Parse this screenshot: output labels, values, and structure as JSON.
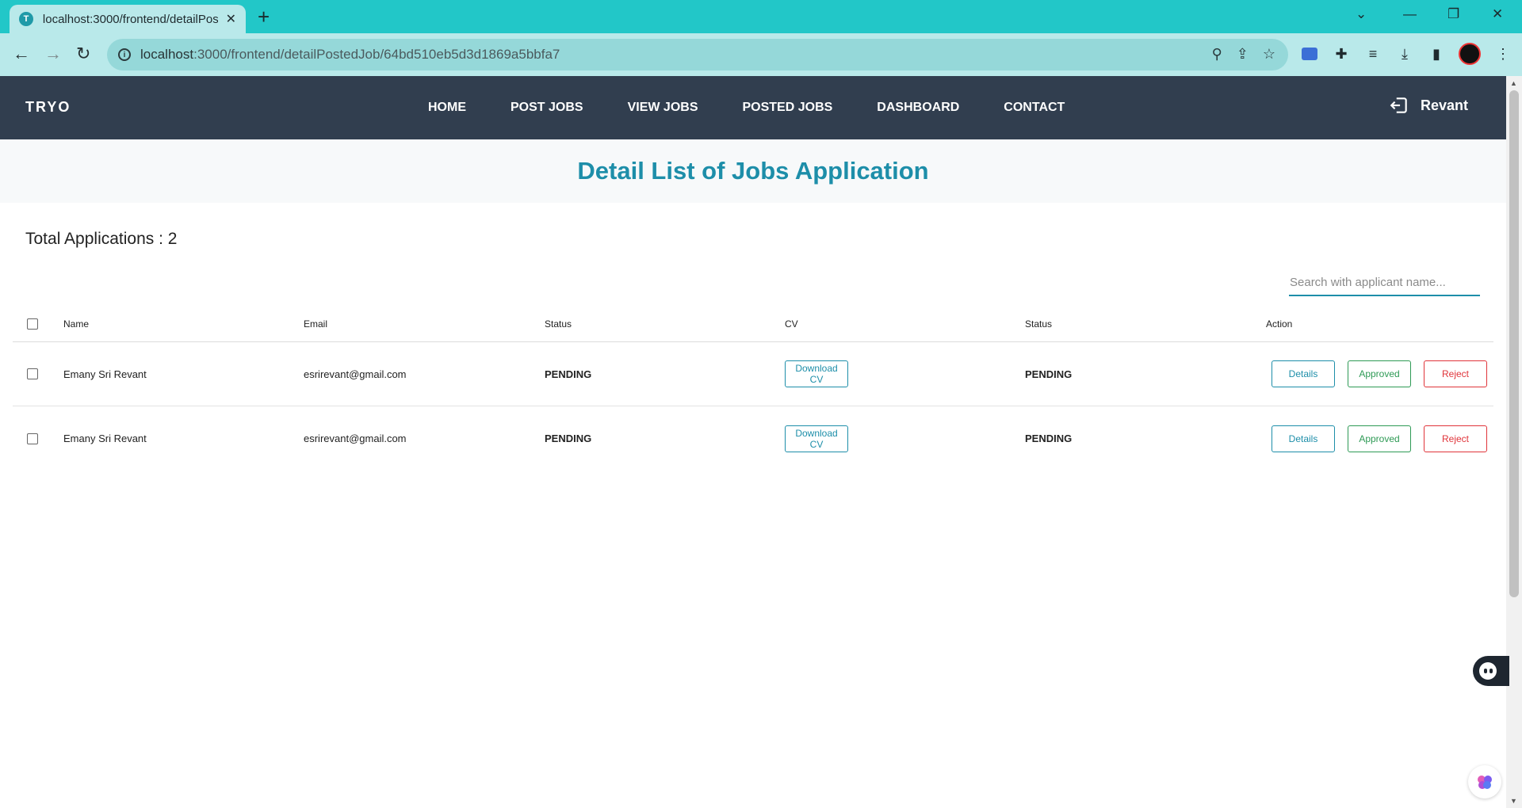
{
  "browser": {
    "tab_title": "localhost:3000/frontend/detailPostedJob/64bd510eb5d3d1869a5bbfa7",
    "tab_favicon_letter": "T",
    "url_host": "localhost",
    "url_rest": ":3000/frontend/detailPostedJob/64bd510eb5d3d1869a5bbfa7"
  },
  "navbar": {
    "brand": "TRYO",
    "links": [
      "HOME",
      "POST JOBS",
      "VIEW JOBS",
      "POSTED JOBS",
      "DASHBOARD",
      "CONTACT"
    ],
    "username": "Revant"
  },
  "page": {
    "title": "Detail List of Jobs Application",
    "total_label": "Total Applications : 2",
    "search_placeholder": "Search with applicant name..."
  },
  "table": {
    "headers": {
      "name": "Name",
      "email": "Email",
      "status": "Status",
      "cv": "CV",
      "status2": "Status",
      "action": "Action"
    },
    "rows": [
      {
        "name": "Emany Sri Revant",
        "email": "esrirevant@gmail.com",
        "status": "PENDING",
        "cv_label": "Download CV",
        "status2": "PENDING",
        "details_label": "Details",
        "approve_label": "Approved",
        "reject_label": "Reject"
      },
      {
        "name": "Emany Sri Revant",
        "email": "esrirevant@gmail.com",
        "status": "PENDING",
        "cv_label": "Download CV",
        "status2": "PENDING",
        "details_label": "Details",
        "approve_label": "Approved",
        "reject_label": "Reject"
      }
    ]
  },
  "colors": {
    "tab_strip": "#22c7c8",
    "navbar_bg": "#313e4f",
    "accent": "#1d8ea9",
    "approve": "#2e9a55",
    "reject": "#e0343a"
  }
}
